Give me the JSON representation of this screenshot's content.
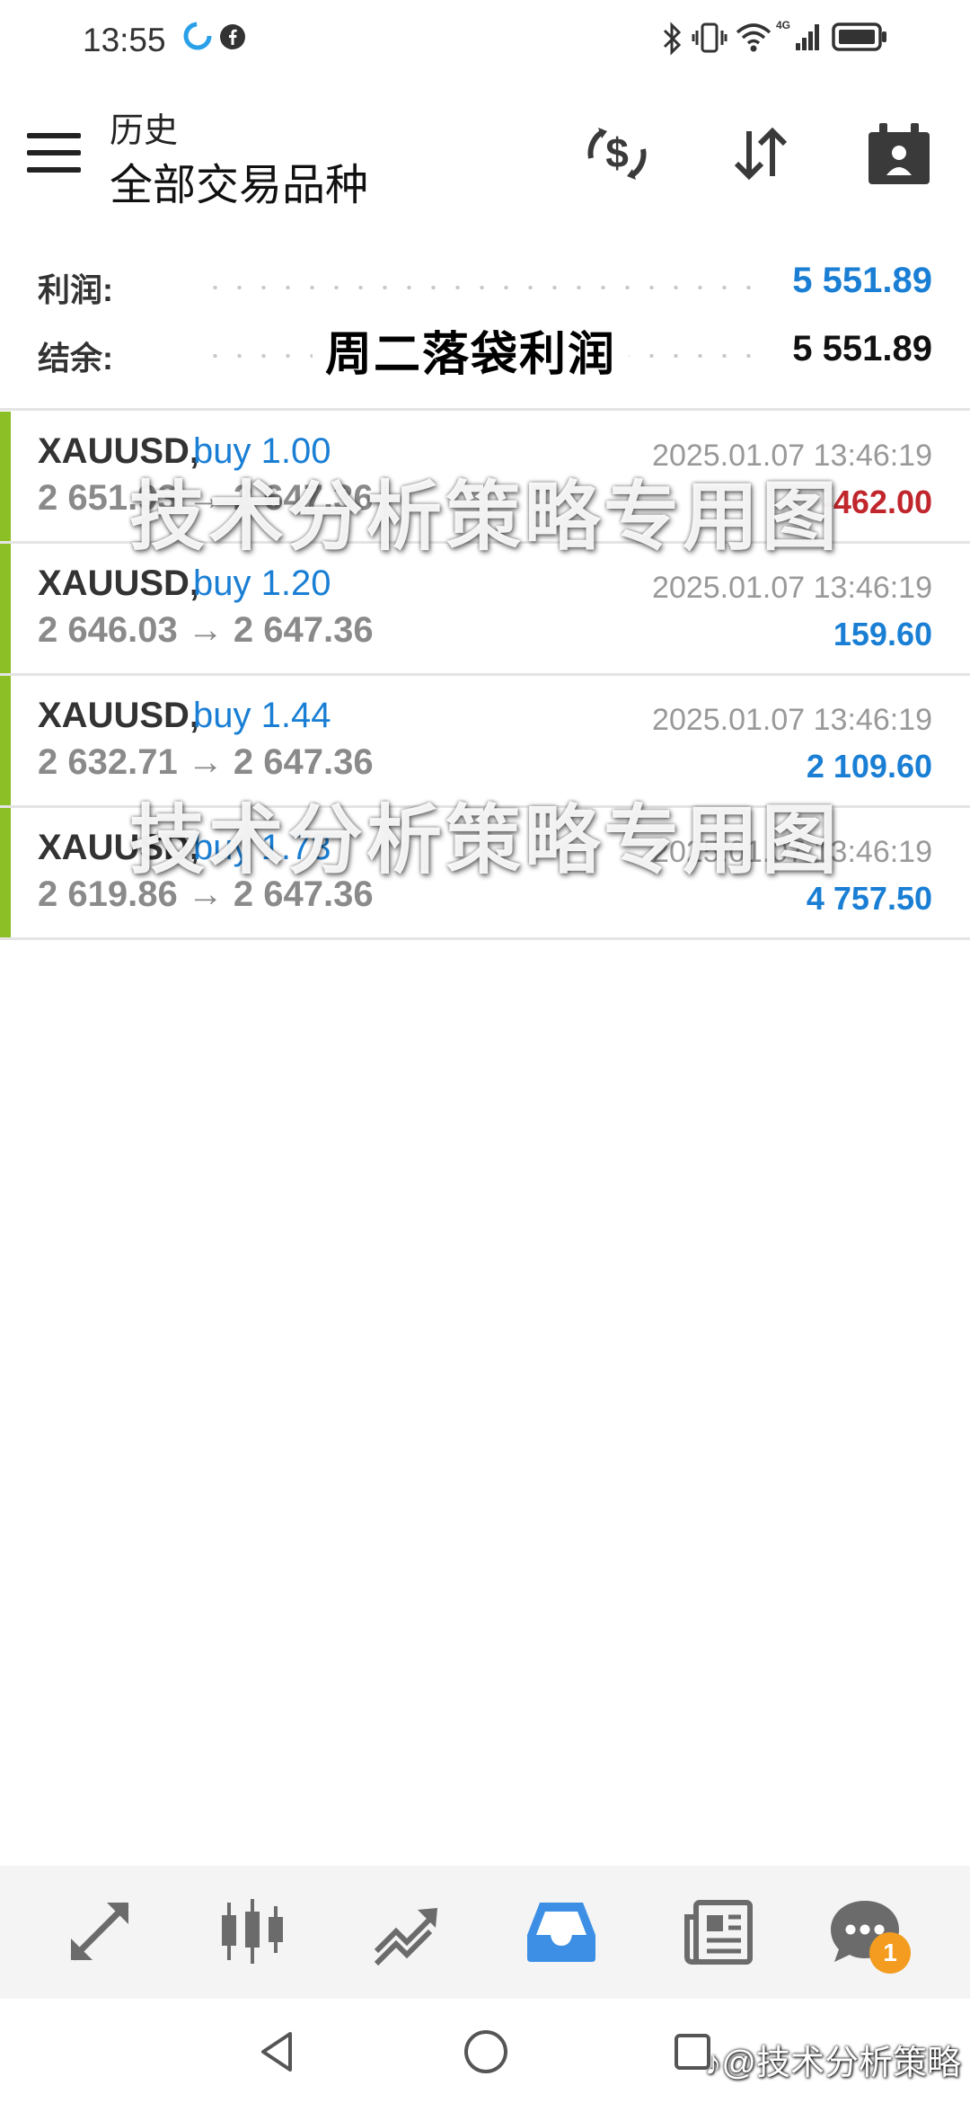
{
  "status_bar": {
    "time": "13:55",
    "network": "4G"
  },
  "header": {
    "subtitle": "历史",
    "title": "全部交易品种"
  },
  "summary": {
    "profit_label": "利润:",
    "profit_value": "5 551.89",
    "balance_label": "结余:",
    "balance_value": "5 551.89",
    "caption": "周二落袋利润"
  },
  "trades": [
    {
      "symbol": "XAUUSD,",
      "side": "buy 1.00",
      "prices": "2 651.93 → 2 647.36",
      "time": "2025.01.07 13:46:19",
      "profit": "-462.00",
      "profit_color": "#c0262c"
    },
    {
      "symbol": "XAUUSD,",
      "side": "buy 1.20",
      "prices": "2 646.03 → 2 647.36",
      "time": "2025.01.07 13:46:19",
      "profit": "159.60",
      "profit_color": "#1a7fd4"
    },
    {
      "symbol": "XAUUSD,",
      "side": "buy 1.44",
      "prices": "2 632.71 → 2 647.36",
      "time": "2025.01.07 13:46:19",
      "profit": "2 109.60",
      "profit_color": "#1a7fd4"
    },
    {
      "symbol": "XAUUSD,",
      "side": "buy 1.73",
      "prices": "2 619.86 → 2 647.36",
      "time": "2025.01.07 13:46:19",
      "profit": "4 757.50",
      "profit_color": "#1a7fd4"
    }
  ],
  "watermarks": {
    "text1": "技术分析策略专用图",
    "text2": "技术分析策略专用图",
    "account": "@技术分析策略"
  },
  "bottom_nav": {
    "items": [
      {
        "icon": "quotes-icon",
        "active": false
      },
      {
        "icon": "chart-icon",
        "active": false
      },
      {
        "icon": "trade-icon",
        "active": false
      },
      {
        "icon": "history-icon",
        "active": true
      },
      {
        "icon": "news-icon",
        "active": false
      },
      {
        "icon": "chat-icon",
        "active": false
      }
    ],
    "chat_badge": "1",
    "active_color": "#3d8fe6",
    "inactive_color": "#6b6b6b"
  }
}
